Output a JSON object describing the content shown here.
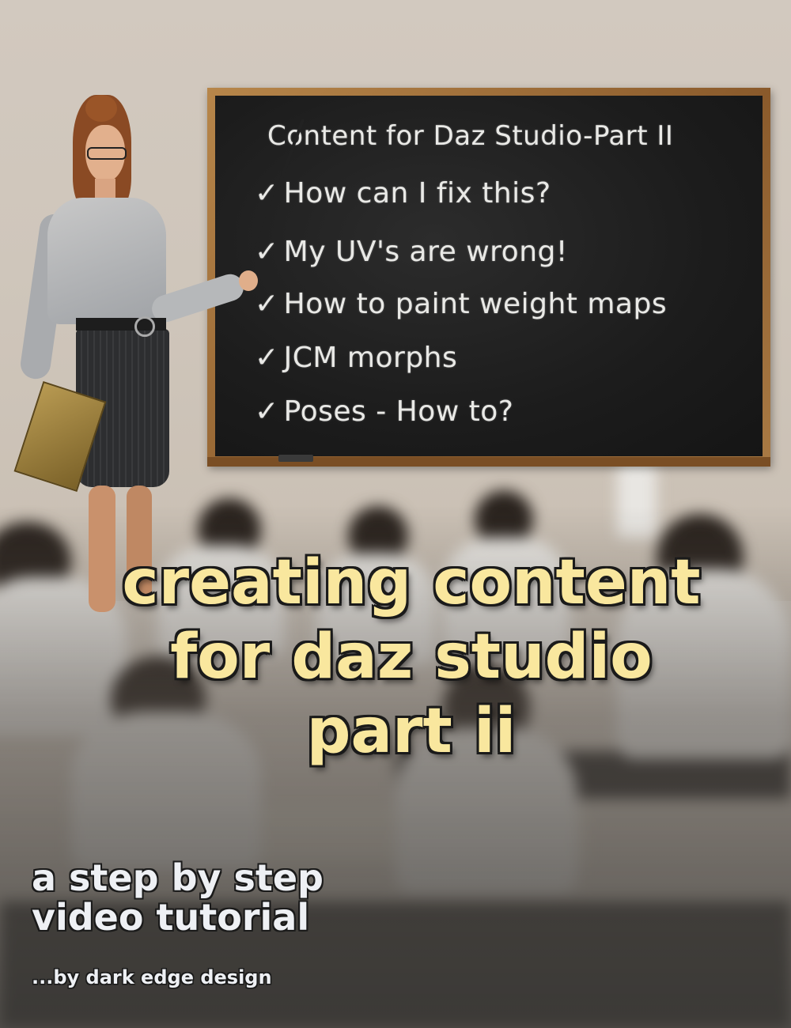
{
  "board": {
    "title": "Content for Daz Studio-Part II",
    "tick": "✓",
    "items": [
      "How can I fix this?",
      "My UV's are wrong!",
      "How to paint weight maps",
      "JCM morphs",
      "Poses - How to?"
    ]
  },
  "headline": {
    "line1": "creating content",
    "line2": "for daz studio",
    "line3": "part ii"
  },
  "subtitle": {
    "line1": "a step by step",
    "line2": "video tutorial"
  },
  "byline": "...by dark edge design",
  "colors": {
    "headline": "#f9e79e",
    "subtitle": "#eef0f4",
    "chalkboard": "#1c1c1c",
    "frame": "#a97a44"
  }
}
